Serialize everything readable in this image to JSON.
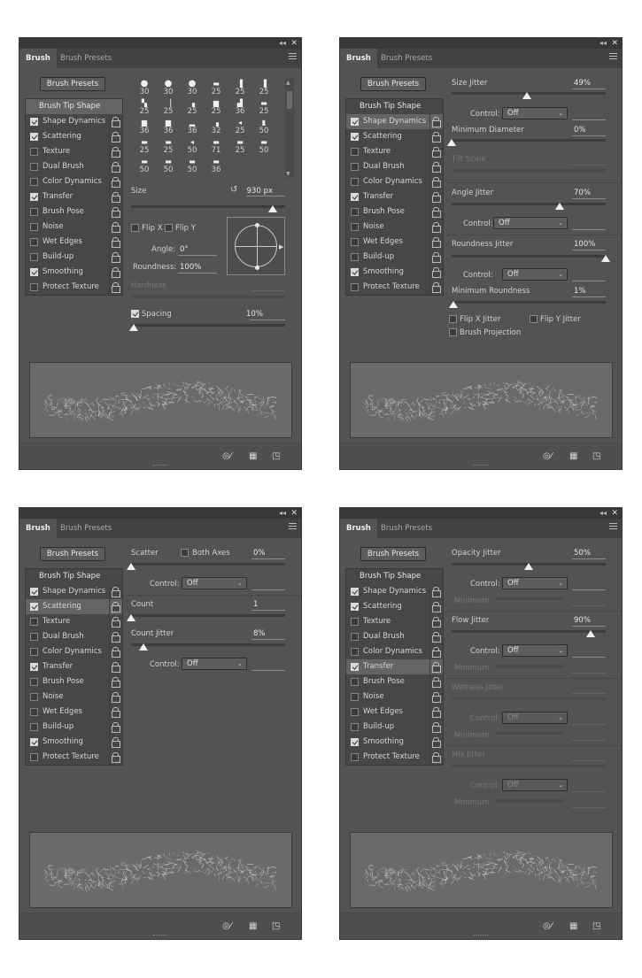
{
  "common": {
    "tabs": [
      "Brush",
      "Brush Presets"
    ],
    "presets_button": "Brush Presets",
    "double_arrow": "◂◂",
    "close": "✕",
    "items": [
      {
        "label": "Brush Tip Shape",
        "checked": null
      },
      {
        "label": "Shape Dynamics",
        "checked": true
      },
      {
        "label": "Scattering",
        "checked": true
      },
      {
        "label": "Texture",
        "checked": false
      },
      {
        "label": "Dual Brush",
        "checked": false
      },
      {
        "label": "Color Dynamics",
        "checked": false
      },
      {
        "label": "Transfer",
        "checked": true
      },
      {
        "label": "Brush Pose",
        "checked": false
      },
      {
        "label": "Noise",
        "checked": false
      },
      {
        "label": "Wet Edges",
        "checked": false
      },
      {
        "label": "Build-up",
        "checked": false
      },
      {
        "label": "Smoothing",
        "checked": true
      },
      {
        "label": "Protect Texture",
        "checked": false
      }
    ]
  },
  "panels": [
    {
      "id": "p1",
      "selected_item": 0,
      "tip_grid": {
        "sizes": [
          "30",
          "30",
          "30",
          "25",
          "25",
          "25",
          "25",
          "25",
          "25",
          "25",
          "36",
          "25",
          "36",
          "36",
          "36",
          "32",
          "25",
          "50",
          "25",
          "25",
          "50",
          "71",
          "25",
          "50",
          "50",
          "50",
          "50",
          "36"
        ]
      },
      "size_label": "Size",
      "size_value": "930 px",
      "flip_x": "Flip X",
      "flip_y": "Flip Y",
      "angle_label": "Angle:",
      "angle_value": "0°",
      "roundness_label": "Roundness:",
      "roundness_value": "100%",
      "hardness_label": "Hardness",
      "spacing_label": "Spacing",
      "spacing_value": "10%"
    },
    {
      "id": "p2",
      "selected_item": 1,
      "size_jitter_label": "Size Jitter",
      "size_jitter_value": "49%",
      "control_label": "Control:",
      "control_value": "Off",
      "min_diameter_label": "Minimum Diameter",
      "min_diameter_value": "0%",
      "tilt_scale_label": "Tilt Scale",
      "angle_jitter_label": "Angle Jitter",
      "angle_jitter_value": "70%",
      "roundness_jitter_label": "Roundness Jitter",
      "roundness_jitter_value": "100%",
      "min_roundness_label": "Minimum Roundness",
      "min_roundness_value": "1%",
      "flip_x_jitter": "Flip X Jitter",
      "flip_y_jitter": "Flip Y Jitter",
      "brush_projection": "Brush Projection"
    },
    {
      "id": "p3",
      "selected_item": 2,
      "scatter_label": "Scatter",
      "both_axes_label": "Both Axes",
      "scatter_value": "0%",
      "control_label": "Control:",
      "control_value": "Off",
      "count_label": "Count",
      "count_value": "1",
      "count_jitter_label": "Count Jitter",
      "count_jitter_value": "8%"
    },
    {
      "id": "p4",
      "selected_item": 6,
      "opacity_jitter_label": "Opacity Jitter",
      "opacity_jitter_value": "50%",
      "control_label": "Control:",
      "control_value": "Off",
      "minimum_label": "Minimum",
      "flow_jitter_label": "Flow Jitter",
      "flow_jitter_value": "90%",
      "wetness_jitter_label": "Wetness Jitter",
      "mix_jitter_label": "Mix Jitter"
    }
  ],
  "levels": {
    "p1_size": 0.92,
    "p1_spacing": 0.02,
    "p2_size_jitter": 0.49,
    "p2_min_diameter": 0.0,
    "p2_angle_jitter": 0.7,
    "p2_roundness_jitter": 1.0,
    "p2_min_roundness": 0.01,
    "p3_scatter": 0.0,
    "p3_count": 0.0,
    "p3_count_jitter": 0.08,
    "p4_opacity_jitter": 0.5,
    "p4_flow_jitter": 0.9
  },
  "icons": [
    "panel-menu-icon",
    "lock-icon",
    "create-new-preset-icon",
    "toggle-live-tip-preview-icon",
    "open-preset-manager-icon",
    "rotate-reset-icon"
  ]
}
